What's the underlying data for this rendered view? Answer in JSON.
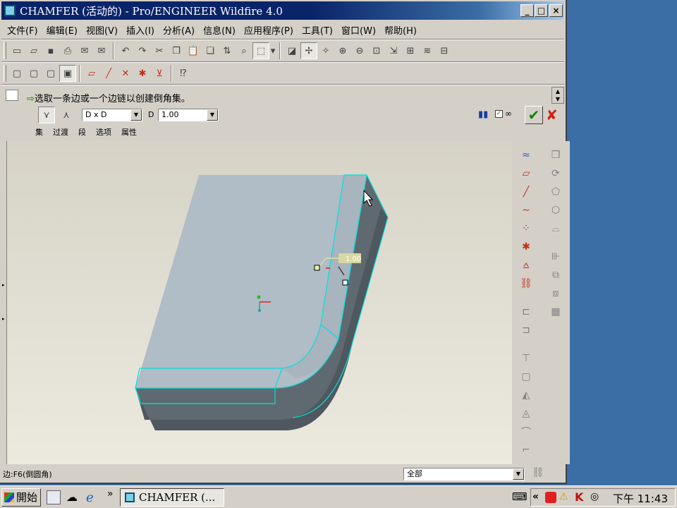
{
  "window": {
    "title": "CHAMFER (活动的) - Pro/ENGINEER Wildfire 4.0",
    "minimize": "_",
    "maximize": "□",
    "close": "×"
  },
  "menu": [
    "文件(F)",
    "编辑(E)",
    "视图(V)",
    "插入(I)",
    "分析(A)",
    "信息(N)",
    "应用程序(P)",
    "工具(T)",
    "窗口(W)",
    "帮助(H)"
  ],
  "dashboard": {
    "prompt": "选取一条边或一个边链以创建倒角集。",
    "scheme_value": "D x D",
    "d_label": "D",
    "d_value": "1.00",
    "tabs": [
      "集",
      "过渡",
      "段",
      "选项",
      "属性"
    ],
    "pause_icon": "pause-icon",
    "preview_icon": "glasses-icon",
    "ok_icon": "check-icon",
    "cancel_icon": "x-icon"
  },
  "model": {
    "dimension_label": "1.00",
    "edge_color": "#00e0e0",
    "top_face_color": "#b0bcc6",
    "side_face_color": "#606a70"
  },
  "status": {
    "text": "边:F6(倒圆角)",
    "filter": "全部"
  },
  "taskbar": {
    "start": "開始",
    "task_label": "CHAMFER (...",
    "chevron": "»",
    "tray_chevron": "«",
    "clock": "下午 11:43"
  }
}
